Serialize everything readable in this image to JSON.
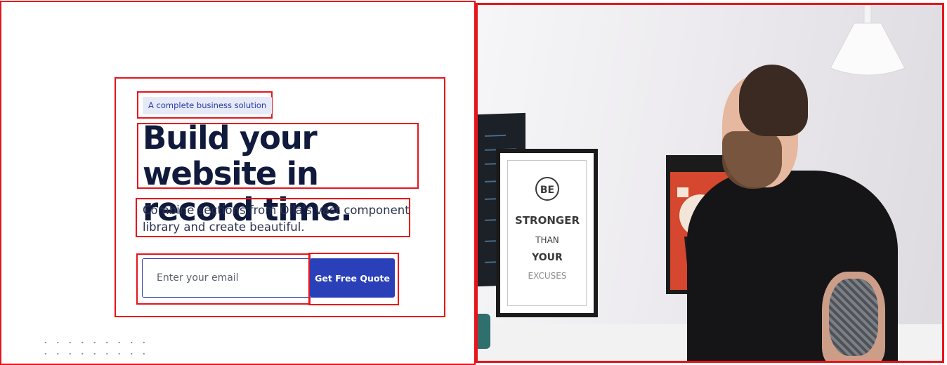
{
  "hero": {
    "badge": "A complete business solution",
    "title": "Build your website in record time.",
    "subtitle": "Combine sections from Olla's vast component library and create beautiful."
  },
  "form": {
    "email_placeholder": "Enter your email",
    "submit_label": "Get Free Quote"
  },
  "colors": {
    "accent": "#2a40b8",
    "title_text": "#101a3c",
    "badge_bg": "#e6eaf7",
    "highlight_border": "#e8141b"
  },
  "image": {
    "icon_name": "hero-photo-icon"
  },
  "poster": {
    "line1": "BE",
    "line2": "STRONGER",
    "line3": "THAN",
    "line4": "YOUR",
    "line5": "EXCUSES"
  }
}
